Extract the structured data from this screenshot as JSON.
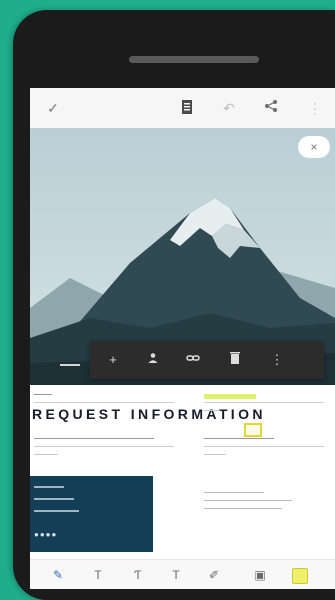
{
  "colors": {
    "background": "#1fae8c",
    "phone": "#1b1b1b",
    "toolbar_dark": "#2c2c2c",
    "card": "#143e57",
    "highlight": "#dff06a",
    "accent_pen": "#3a6ab8"
  },
  "appbar": {
    "icons": [
      "check-icon",
      "document-icon",
      "undo-icon",
      "share-icon",
      "more-vertical-icon"
    ]
  },
  "hero": {
    "close_label": "×"
  },
  "document": {
    "title": "REQUEST INFORMATION"
  },
  "floating_toolbar": {
    "icons": [
      "plus-icon",
      "person-icon",
      "link-icon",
      "trash-icon",
      "more-vertical-icon"
    ],
    "glyphs": [
      "+",
      "⚇",
      "⚭",
      "🗑",
      "⋮"
    ]
  },
  "bottom_toolbar": {
    "icons": [
      "pen-icon",
      "text-icon",
      "text-cursor-icon",
      "text-format-icon",
      "signature-icon",
      "image-icon",
      "sticky-note-icon"
    ],
    "glyphs": [
      "✎",
      "T",
      "Ƭ",
      "T",
      "✐",
      "▣",
      ""
    ]
  }
}
